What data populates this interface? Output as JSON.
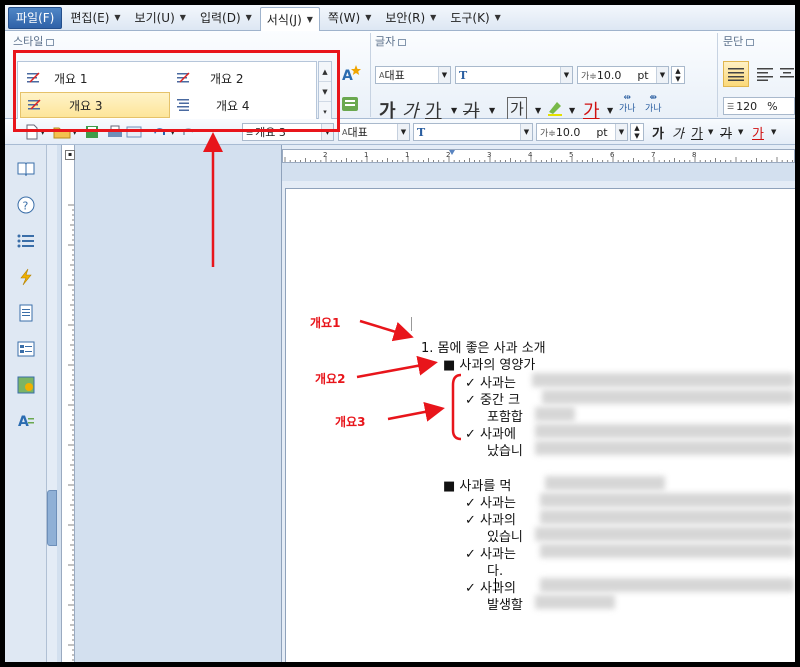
{
  "menubar": {
    "items": [
      {
        "label": "파일(F)",
        "arrow": false
      },
      {
        "label": "편집(E)",
        "arrow": true
      },
      {
        "label": "보기(U)",
        "arrow": true
      },
      {
        "label": "입력(D)",
        "arrow": true
      },
      {
        "label": "서식(J)",
        "arrow": true
      },
      {
        "label": "쪽(W)",
        "arrow": true
      },
      {
        "label": "보안(R)",
        "arrow": true
      },
      {
        "label": "도구(K)",
        "arrow": true
      }
    ]
  },
  "ribbon": {
    "style_group": "스타일",
    "styles": [
      "개요 1",
      "개요 2",
      "개요 3",
      "개요 4"
    ],
    "font_group": "글자",
    "para_group": "문단",
    "font_lang": "대표",
    "font_name": "T",
    "font_size": "10.0",
    "font_unit": "pt",
    "line_spacing": "120",
    "line_unit": "%",
    "bold": "가",
    "italic": "가",
    "underline": "가",
    "strike": "가",
    "outline": "가",
    "color_a": "가",
    "kern_a": "가나",
    "kern_b": "가나"
  },
  "toolbar": {
    "style_value": "개요 3",
    "font_lang": "대표",
    "font_name": "T",
    "font_size": "10.0",
    "font_unit": "pt",
    "bold": "가",
    "italic": "가",
    "underline": "가",
    "strike": "가",
    "color": "가"
  },
  "ruler": {
    "marks": [
      "2",
      "1",
      "1",
      "2",
      "3",
      "4",
      "5",
      "6",
      "7",
      "8"
    ]
  },
  "document": {
    "h1": "1. 몸에 좋은 사과 소개",
    "h2a": "■ 사과의 영양가",
    "b1": "✓ 사과는",
    "b2": "✓ 중간 크",
    "b2c": "포함합",
    "b3": "✓ 사과에",
    "b3c": "났습니",
    "h2b": "■  사과를 먹",
    "c1": "✓  사과는",
    "c2": "✓  사과의",
    "c2c": "있습니",
    "c3": "✓  사과는",
    "c3c": "다.",
    "c4": "✓  사과의",
    "c4c": "발생할"
  },
  "annotations": {
    "a1": "개요1",
    "a2": "개요2",
    "a3": "개요3"
  },
  "colors": {
    "highlight": "#e8151b",
    "accent": "#2f62a8"
  }
}
